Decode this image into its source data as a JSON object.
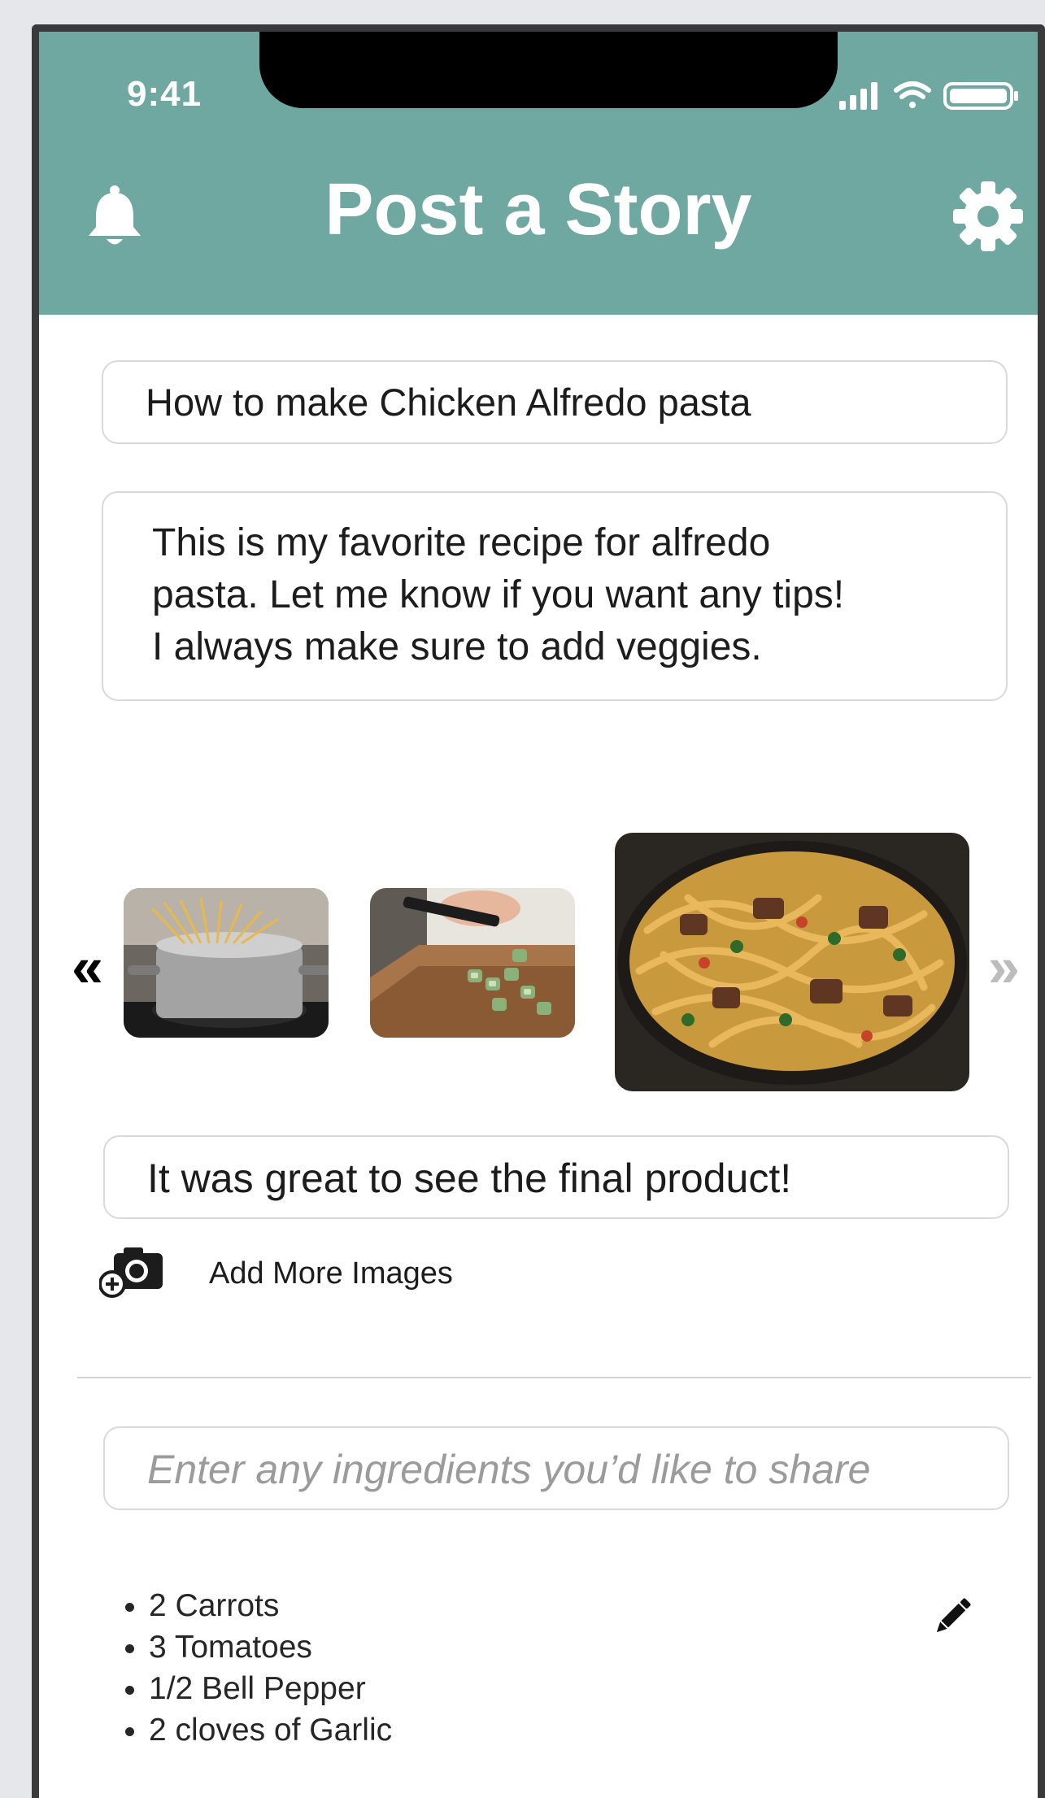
{
  "status_bar": {
    "time": "9:41",
    "icons": [
      "signal-icon",
      "wifi-icon",
      "battery-icon"
    ]
  },
  "header": {
    "title": "Post a Story",
    "left_icon": "bell-icon",
    "right_icon": "gear-icon"
  },
  "story": {
    "title_value": "How to make Chicken Alfredo pasta",
    "description_lines": [
      "This is my favorite recipe for alfredo",
      "pasta. Let me know if you want any tips!",
      "I always make sure to add veggies."
    ]
  },
  "carousel": {
    "prev_icon": "chevron-double-left-icon",
    "next_icon": "chevron-double-right-icon",
    "images": [
      "pasta-pot-image",
      "chopping-zucchini-image",
      "chicken-alfredo-pasta-image"
    ],
    "selected_caption": "It was great to see the final product!"
  },
  "add_images": {
    "icon": "add-camera-icon",
    "label": "Add More Images"
  },
  "ingredients": {
    "placeholder": "Enter any ingredients you’d like to share",
    "items": [
      "2 Carrots",
      "3 Tomatoes",
      "1/2 Bell Pepper",
      "2 cloves of Garlic"
    ],
    "edit_icon": "pencil-icon"
  },
  "colors": {
    "header_bg": "#6fa8a0",
    "header_text": "#ffffff",
    "frame": "#3a3a3c",
    "field_border": "#d9d9d9",
    "placeholder_text": "#9b9b9b",
    "disabled_chevron": "#bcbcbc"
  }
}
